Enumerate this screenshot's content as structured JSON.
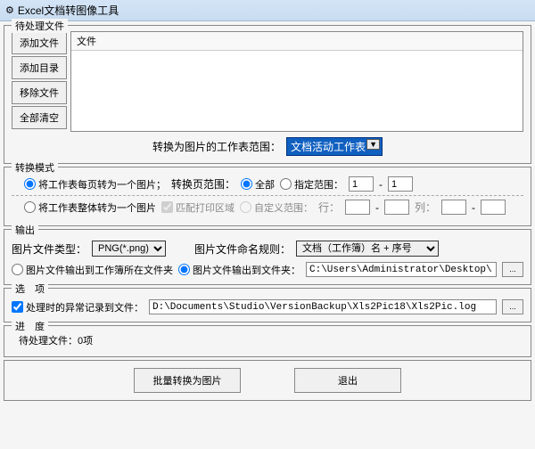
{
  "window": {
    "title": "Excel文档转图像工具"
  },
  "pending": {
    "group_label": "待处理文件",
    "buttons": {
      "add_file": "添加文件",
      "add_dir": "添加目录",
      "remove": "移除文件",
      "clear": "全部清空"
    },
    "list_header": "文件",
    "sheet_range_label": "转换为图片的工作表范围：",
    "sheet_range_value": "文档活动工作表"
  },
  "mode": {
    "group_label": "转换模式",
    "per_page_label": "将工作表每页转为一个图片；",
    "page_range_label": "转换页范围：",
    "all_label": "全部",
    "custom_range_label": "指定范围：",
    "range_from": "1",
    "range_to": "1",
    "whole_sheet_label": "将工作表整体转为一个图片",
    "match_print_label": "匹配打印区域",
    "custom_area_label": "自定义范围：",
    "row_label": "行：",
    "col_label": "列：",
    "dash": "-"
  },
  "output": {
    "group_label": "输出",
    "file_type_label": "图片文件类型：",
    "file_type_value": "PNG(*.png)",
    "naming_label": "图片文件命名规则：",
    "naming_value": "文档（工作簿）名 + 序号",
    "to_workbook_label": "图片文件输出到工作簿所在文件夹",
    "to_folder_label": "图片文件输出到文件夹：",
    "folder_path": "C:\\Users\\Administrator\\Desktop\\"
  },
  "options": {
    "group_label": "选　项",
    "log_label": "处理时的异常记录到文件：",
    "log_path": "D:\\Documents\\Studio\\VersionBackup\\Xls2Pic18\\Xls2Pic.log"
  },
  "progress": {
    "group_label": "进　度",
    "text_prefix": "待处理文件：",
    "count_text": "0项"
  },
  "footer": {
    "convert": "批量转换为图片",
    "exit": "退出"
  },
  "browse_label": "..."
}
